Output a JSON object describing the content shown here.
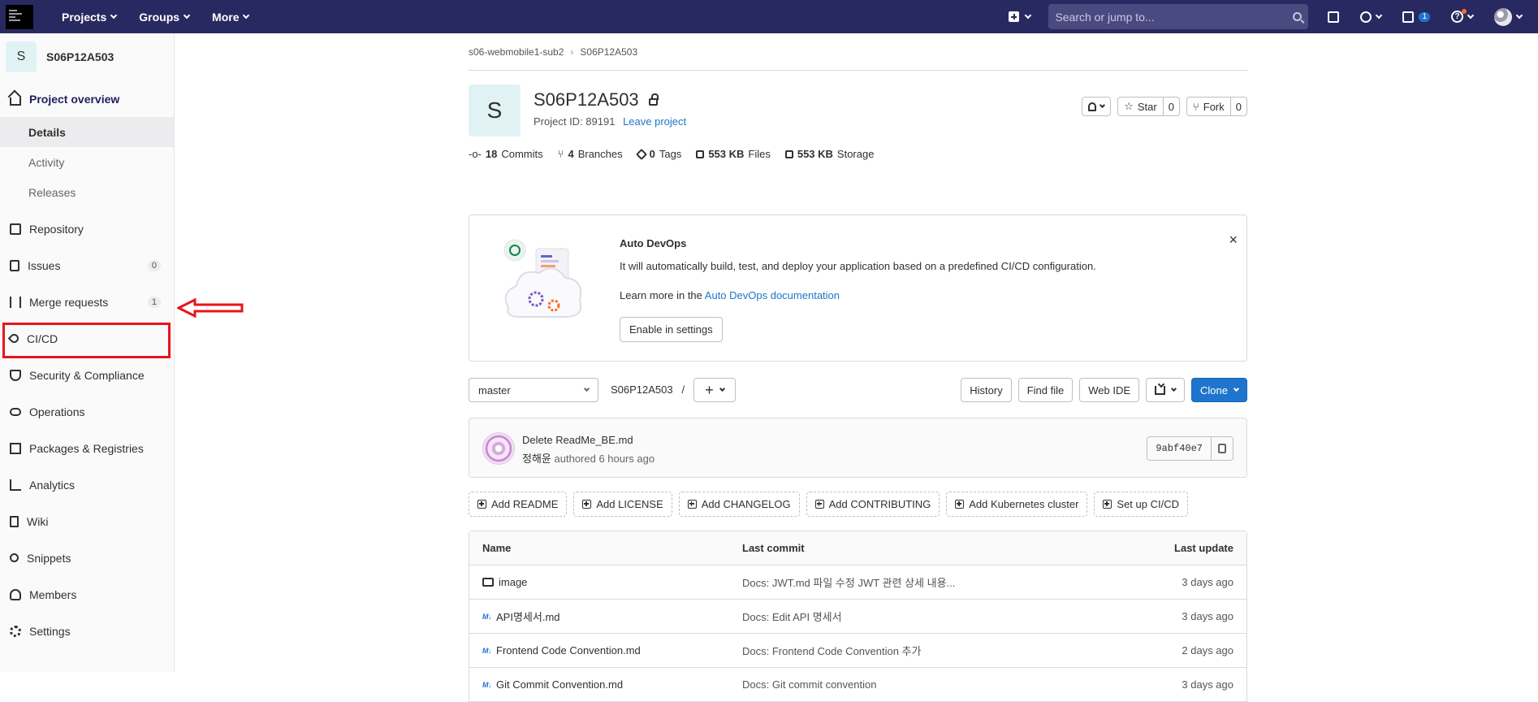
{
  "topbar": {
    "menu": [
      "Projects",
      "Groups",
      "More"
    ],
    "search_placeholder": "Search or jump to...",
    "todo_count": "1",
    "help_label": "?"
  },
  "sidebar": {
    "project_initial": "S",
    "project_name": "S06P12A503",
    "overview": "Project overview",
    "sub_items": [
      "Details",
      "Activity",
      "Releases"
    ],
    "items": [
      {
        "label": "Repository"
      },
      {
        "label": "Issues",
        "count": "0"
      },
      {
        "label": "Merge requests",
        "count": "1"
      },
      {
        "label": "CI/CD"
      },
      {
        "label": "Security & Compliance"
      },
      {
        "label": "Operations"
      },
      {
        "label": "Packages & Registries"
      },
      {
        "label": "Analytics"
      },
      {
        "label": "Wiki"
      },
      {
        "label": "Snippets"
      },
      {
        "label": "Members"
      },
      {
        "label": "Settings"
      }
    ]
  },
  "breadcrumb": [
    "s06-webmobile1-sub2",
    "S06P12A503"
  ],
  "project": {
    "initial": "S",
    "title": "S06P12A503",
    "id_text": "Project ID: 89191",
    "leave": "Leave project",
    "star_label": "Star",
    "star_count": "0",
    "fork_label": "Fork",
    "fork_count": "0"
  },
  "stats": {
    "commits_n": "18",
    "commits_l": "Commits",
    "branches_n": "4",
    "branches_l": "Branches",
    "tags_n": "0",
    "tags_l": "Tags",
    "files_n": "553 KB",
    "files_l": "Files",
    "storage_n": "553 KB",
    "storage_l": "Storage"
  },
  "devops": {
    "title": "Auto DevOps",
    "line1": "It will automatically build, test, and deploy your application based on a predefined CI/CD configuration.",
    "line2_prefix": "Learn more in the ",
    "line2_link": "Auto DevOps documentation",
    "button": "Enable in settings",
    "close": "×"
  },
  "toolbar": {
    "branch": "master",
    "path": "S06P12A503",
    "sep": "/",
    "history": "History",
    "find_file": "Find file",
    "web_ide": "Web IDE",
    "clone": "Clone"
  },
  "commit": {
    "title": "Delete ReadMe_BE.md",
    "author": "정해윤",
    "meta": "authored 6 hours ago",
    "sha": "9abf40e7"
  },
  "quick_actions": [
    "Add README",
    "Add LICENSE",
    "Add CHANGELOG",
    "Add CONTRIBUTING",
    "Add Kubernetes cluster",
    "Set up CI/CD"
  ],
  "files": {
    "headers": {
      "name": "Name",
      "last_commit": "Last commit",
      "last_update": "Last update"
    },
    "rows": [
      {
        "type": "folder",
        "name": "image",
        "commit": "Docs: JWT.md 파일 수정 JWT 관련 상세 내용...",
        "updated": "3 days ago"
      },
      {
        "type": "md",
        "name": "API명세서.md",
        "commit": "Docs: Edit API 명세서",
        "updated": "3 days ago"
      },
      {
        "type": "md",
        "name": "Frontend Code Convention.md",
        "commit": "Docs: Frontend Code Convention 추가",
        "updated": "2 days ago"
      },
      {
        "type": "md",
        "name": "Git Commit Convention.md",
        "commit": "Docs: Git commit convention",
        "updated": "3 days ago"
      }
    ],
    "md_icon": "M↓"
  },
  "colors": {
    "nav": "#292961",
    "primary": "#1f75cb",
    "highlight": "#e8141b"
  }
}
